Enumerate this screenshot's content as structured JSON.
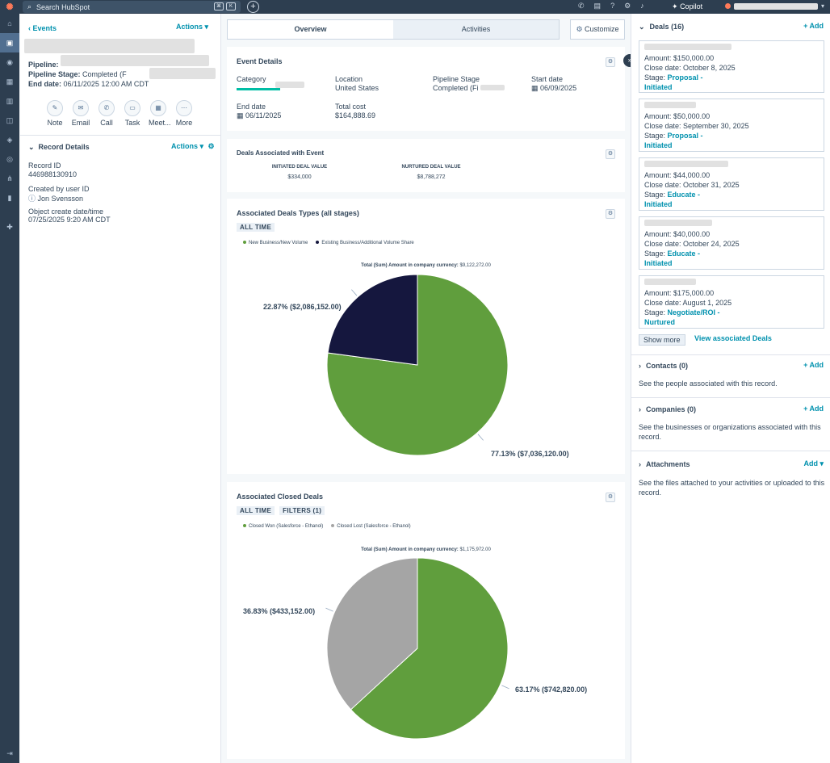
{
  "topbar": {
    "search_placeholder": "Search HubSpot",
    "copilot": "Copilot"
  },
  "record": {
    "back": "Events",
    "actions": "Actions",
    "pipeline_label": "Pipeline:",
    "stage_label": "Pipeline Stage:",
    "stage_value": "Completed (F",
    "end_label": "End date:",
    "end_value": "06/11/2025 12:00 AM CDT",
    "quick_actions": [
      "Note",
      "Email",
      "Call",
      "Task",
      "Meet...",
      "More"
    ]
  },
  "record_details": {
    "title": "Record Details",
    "actions": "Actions",
    "fields": [
      {
        "label": "Record ID",
        "value": "446988130910"
      },
      {
        "label": "Created by user ID",
        "value": "Jon Svensson"
      },
      {
        "label": "Object create date/time",
        "value": "07/25/2025 9:20 AM CDT"
      }
    ]
  },
  "tabs": {
    "overview": "Overview",
    "activities": "Activities",
    "customize": "Customize"
  },
  "event_details": {
    "title": "Event Details",
    "category_label": "Category",
    "location_label": "Location",
    "location_value": "United States",
    "stage_label": "Pipeline Stage",
    "stage_value": "Completed (Fi",
    "start_label": "Start date",
    "start_value": "06/09/2025",
    "end_label": "End date",
    "end_value": "06/11/2025",
    "cost_label": "Total cost",
    "cost_value": "$164,888.69"
  },
  "deals_assoc": {
    "title": "Deals Associated with Event",
    "initiated_label": "INITIATED DEAL VALUE",
    "initiated_value": "$334,000",
    "nurtured_label": "NURTURED DEAL VALUE",
    "nurtured_value": "$8,788,272"
  },
  "chart_data": [
    {
      "type": "pie",
      "title": "Associated Deals Types (all stages)",
      "filter_chips": [
        "ALL TIME"
      ],
      "total_label": "Total (Sum) Amount in company currency:",
      "total_value": "$9,122,272.00",
      "legend_position": "top-left",
      "categories": [
        "New Business/New Volume",
        "Existing Business/Additional Volume Share"
      ],
      "values": [
        7036120.0,
        2086152.0
      ],
      "percents": [
        77.13,
        22.87
      ],
      "labels": [
        "77.13% ($7,036,120.00)",
        "22.87% ($2,086,152.00)"
      ],
      "colors": [
        "#609e3d",
        "#15173e"
      ]
    },
    {
      "type": "pie",
      "title": "Associated Closed Deals",
      "filter_chips": [
        "ALL TIME",
        "FILTERS (1)"
      ],
      "total_label": "Total (Sum) Amount in company currency:",
      "total_value": "$1,175,972.00",
      "legend_position": "top-left",
      "categories": [
        "Closed Won (Salesforce - Ethanol)",
        "Closed Lost (Salesforce - Ethanol)"
      ],
      "values": [
        742820.0,
        433152.0
      ],
      "percents": [
        63.17,
        36.83
      ],
      "labels": [
        "63.17% ($742,820.00)",
        "36.83% ($433,152.00)"
      ],
      "colors": [
        "#609e3d",
        "#a5a5a5"
      ]
    }
  ],
  "sidebar": {
    "deals_title": "Deals (16)",
    "add": "+ Add",
    "amount_label": "Amount:",
    "close_label": "Close date:",
    "stage_label": "Stage:",
    "deals": [
      {
        "amount": "$150,000.00",
        "close": "October 8, 2025",
        "stage1": "Proposal -",
        "stage2": "Initiated"
      },
      {
        "amount": "$50,000.00",
        "close": "September 30, 2025",
        "stage1": "Proposal -",
        "stage2": "Initiated"
      },
      {
        "amount": "$44,000.00",
        "close": "October 31, 2025",
        "stage1": "Educate -",
        "stage2": "Initiated"
      },
      {
        "amount": "$40,000.00",
        "close": "October 24, 2025",
        "stage1": "Educate -",
        "stage2": "Initiated"
      },
      {
        "amount": "$175,000.00",
        "close": "August 1, 2025",
        "stage1": "Negotiate/ROI -",
        "stage2": "Nurtured"
      }
    ],
    "show_more": "Show more",
    "view_assoc": "View associated Deals",
    "contacts_title": "Contacts (0)",
    "contacts_text": "See the people associated with this record.",
    "companies_title": "Companies (0)",
    "companies_text": "See the businesses or organizations associated with this record.",
    "attachments_title": "Attachments",
    "attachments_add": "Add",
    "attachments_text": "See the files attached to your activities or uploaded to this record."
  }
}
